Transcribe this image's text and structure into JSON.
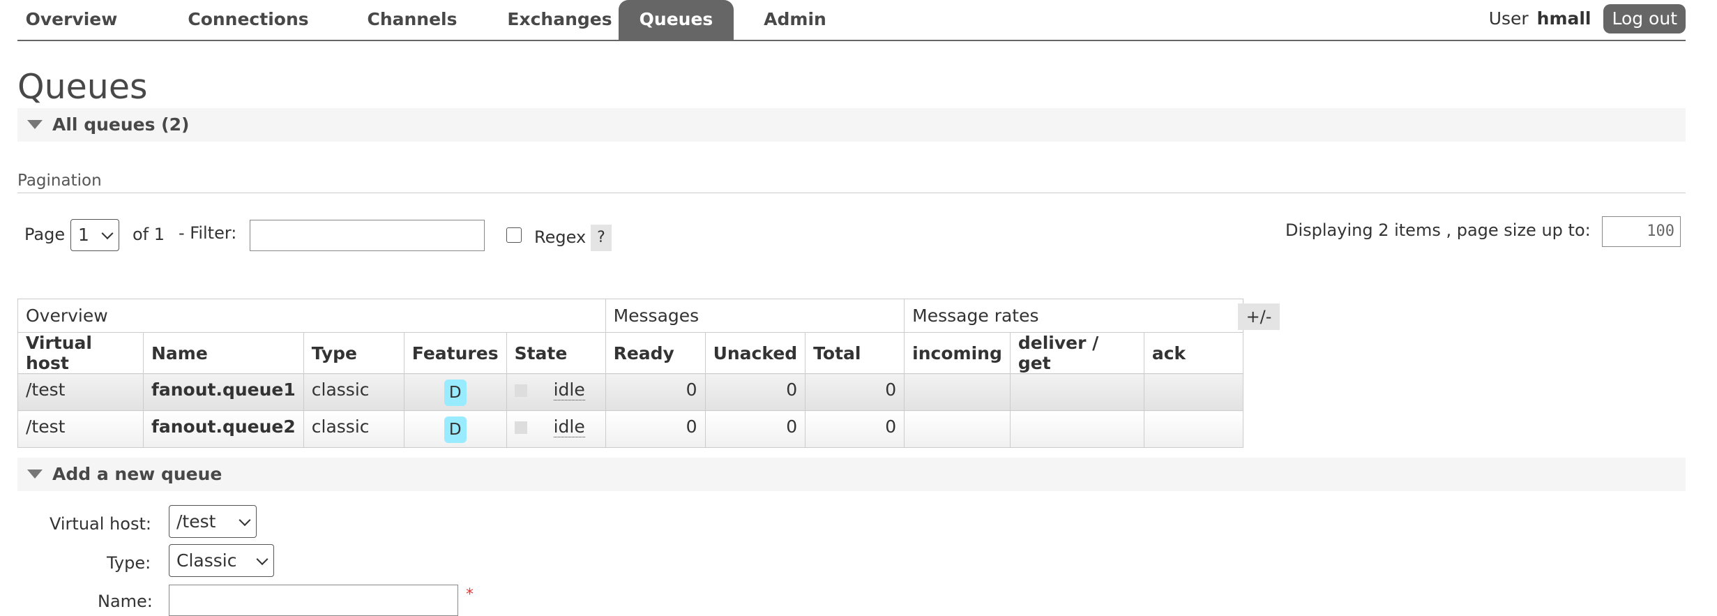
{
  "nav": {
    "tabs": [
      {
        "label": "Overview"
      },
      {
        "label": "Connections"
      },
      {
        "label": "Channels"
      },
      {
        "label": "Exchanges"
      },
      {
        "label": "Queues",
        "active": true
      },
      {
        "label": "Admin"
      }
    ],
    "user_label": "User",
    "user_name": "hmall",
    "logout_label": "Log out"
  },
  "page_title": "Queues",
  "all_queues": {
    "title": "All queues (2)",
    "pagination_title": "Pagination",
    "page_label": "Page",
    "page_value": "1",
    "of_label": "of 1",
    "filter_label": "- Filter:",
    "filter_value": "",
    "regex_label": "Regex",
    "help_label": "?",
    "displaying_label": "Displaying 2 items , page size up to:",
    "page_size": "100"
  },
  "table": {
    "groups": [
      "Overview",
      "Messages",
      "Message rates"
    ],
    "columns": [
      "Virtual host",
      "Name",
      "Type",
      "Features",
      "State",
      "Ready",
      "Unacked",
      "Total",
      "incoming",
      "deliver / get",
      "ack"
    ],
    "plus_minus": "+/-",
    "rows": [
      {
        "vhost": "/test",
        "name": "fanout.queue1",
        "type": "classic",
        "feature": "D",
        "state": "idle",
        "ready": "0",
        "unacked": "0",
        "total": "0",
        "incoming": "",
        "deliver_get": "",
        "ack": ""
      },
      {
        "vhost": "/test",
        "name": "fanout.queue2",
        "type": "classic",
        "feature": "D",
        "state": "idle",
        "ready": "0",
        "unacked": "0",
        "total": "0",
        "incoming": "",
        "deliver_get": "",
        "ack": ""
      }
    ]
  },
  "add_queue": {
    "title": "Add a new queue",
    "vhost_label": "Virtual host:",
    "vhost_value": "/test",
    "type_label": "Type:",
    "type_value": "Classic",
    "name_label": "Name:",
    "name_value": "",
    "required_mark": "*"
  },
  "colors": {
    "nav_active_bg": "#666666",
    "feature_badge": "#99ebff",
    "section_bar": "#f5f5f5"
  }
}
